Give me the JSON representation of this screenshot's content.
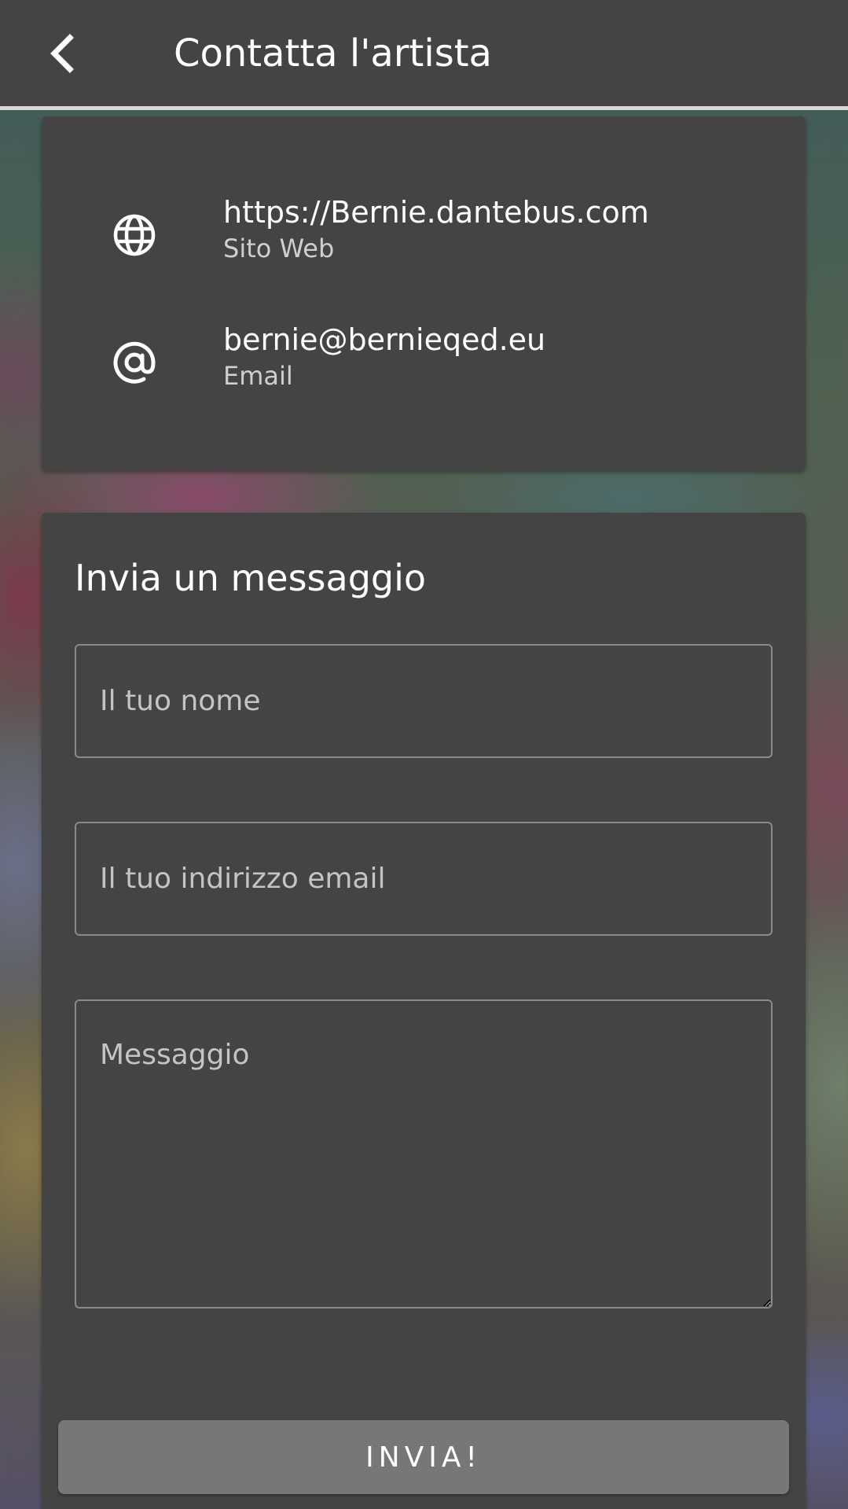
{
  "appbar": {
    "back_icon": "chevron-left-icon",
    "title": "Contatta l'artista"
  },
  "contacts": [
    {
      "icon": "globe-icon",
      "value": "https://Bernie.dantebus.com",
      "label": "Sito Web"
    },
    {
      "icon": "at-sign-icon",
      "value": "bernie@bernieqed.eu",
      "label": "Email"
    }
  ],
  "form": {
    "title": "Invia un messaggio",
    "name_placeholder": "Il tuo nome",
    "email_placeholder": "Il tuo indirizzo email",
    "message_placeholder": "Messaggio",
    "submit_label": "INVIA!"
  },
  "colors": {
    "bar": "#444444",
    "card": "#444444",
    "button": "#777777",
    "text": "#ffffff",
    "secondary_text": "#cfcfcf"
  }
}
